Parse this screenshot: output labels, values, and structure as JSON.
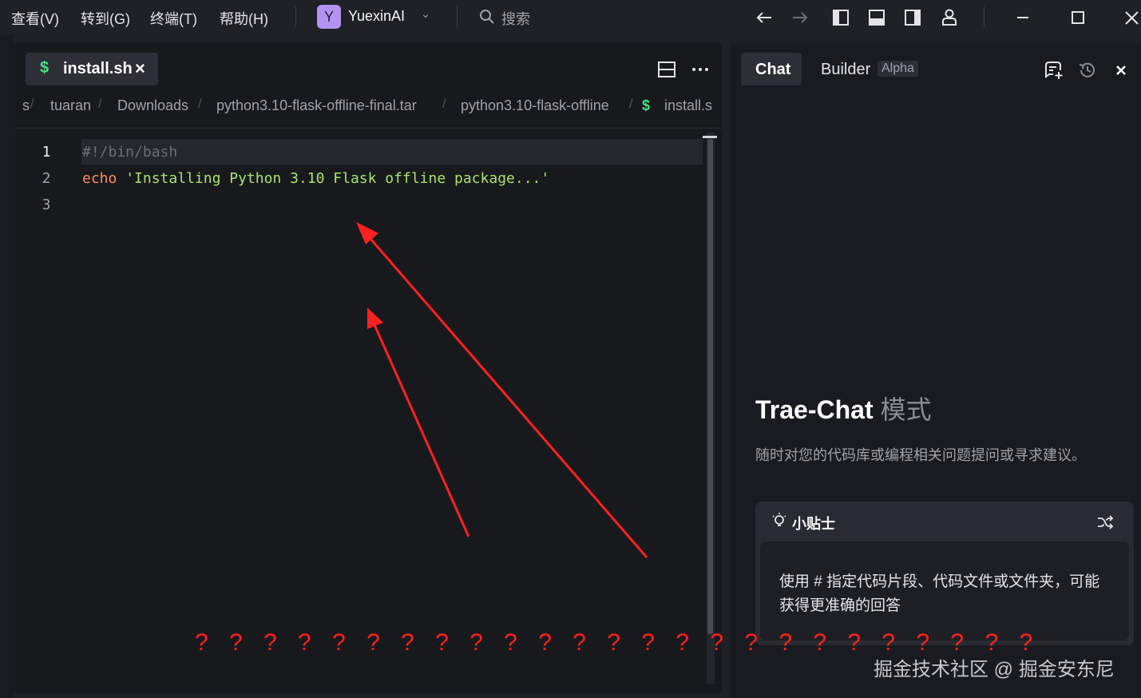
{
  "menu": {
    "items": [
      "查看(V)",
      "转到(G)",
      "终端(T)",
      "帮助(H)"
    ]
  },
  "project": {
    "badge": "Y",
    "name": "YuexinAI"
  },
  "search": {
    "label": "搜索"
  },
  "editor": {
    "tab": {
      "icon": "$",
      "label": "install.sh",
      "close": "×"
    },
    "breadcrumb": {
      "leading": "s",
      "items": [
        "tuaran",
        "Downloads",
        "python3.10-flask-offline-final.tar",
        "python3.10-flask-offline"
      ],
      "file_icon": "$",
      "file": "install.s"
    },
    "lines": [
      {
        "number": "1",
        "text": "#!/bin/bash"
      },
      {
        "number": "2",
        "keyword": "echo",
        "string": "'Installing Python 3.10 Flask offline package...'"
      },
      {
        "number": "3",
        "text": ""
      }
    ]
  },
  "chat": {
    "tabs": {
      "chat": "Chat",
      "builder": "Builder",
      "builder_badge": "Alpha"
    },
    "title": "Trae-Chat",
    "title_suffix": "模式",
    "description": "随时对您的代码库或编程相关问题提问或寻求建议。",
    "tips": {
      "title": "小贴士",
      "text": "使用 # 指定代码片段、代码文件或文件夹，可能获得更准确的回答"
    }
  },
  "annotations": {
    "question_marks": "? ? ? ? ? ? ? ? ? ? ? ? ? ? ? ? ? ? ? ? ? ? ? ? ?",
    "arrow_color": "#ff2020"
  },
  "watermark": "掘金技术社区 @ 掘金安东尼",
  "colors": {
    "background": "#1f2026",
    "editor_bg": "#18191d",
    "accent_green": "#4ade80",
    "keyword": "#ff8a5c",
    "string": "#a7e36a",
    "project_badge": "#b392f0"
  }
}
